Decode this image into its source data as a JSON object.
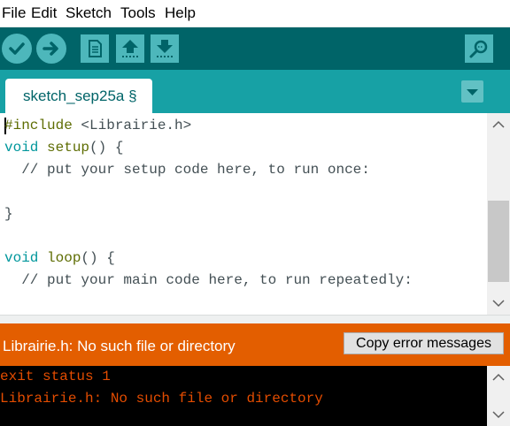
{
  "menu": {
    "items": [
      "File",
      "Edit",
      "Sketch",
      "Tools",
      "Help"
    ]
  },
  "toolbar": {
    "buttons": [
      "verify-icon",
      "upload-icon",
      "new-icon",
      "open-icon",
      "save-icon",
      "serial-monitor-icon"
    ]
  },
  "tabs": {
    "active_label": "sketch_sep25a §"
  },
  "editor": {
    "lines": [
      {
        "parts": [
          "#include",
          " <Librairie.h>"
        ]
      },
      {
        "parts": [
          "void",
          " ",
          "setup",
          "() {"
        ]
      },
      {
        "parts": [
          "  // put your setup code here, to run once:"
        ]
      },
      {
        "parts": [
          ""
        ]
      },
      {
        "parts": [
          "}"
        ]
      },
      {
        "parts": [
          ""
        ]
      },
      {
        "parts": [
          "void",
          " ",
          "loop",
          "() {"
        ]
      },
      {
        "parts": [
          "  // put your main code here, to run repeatedly:"
        ]
      }
    ]
  },
  "status": {
    "message": "Librairie.h: No such file or directory",
    "copy_button_label": "Copy error messages"
  },
  "console": {
    "lines": [
      "exit status 1",
      "Librairie.h: No such file or directory"
    ]
  },
  "colors": {
    "toolbar": "#006468",
    "tabbar": "#17a1a5",
    "error_bar": "#e35e00",
    "console_text": "#e34c00"
  }
}
